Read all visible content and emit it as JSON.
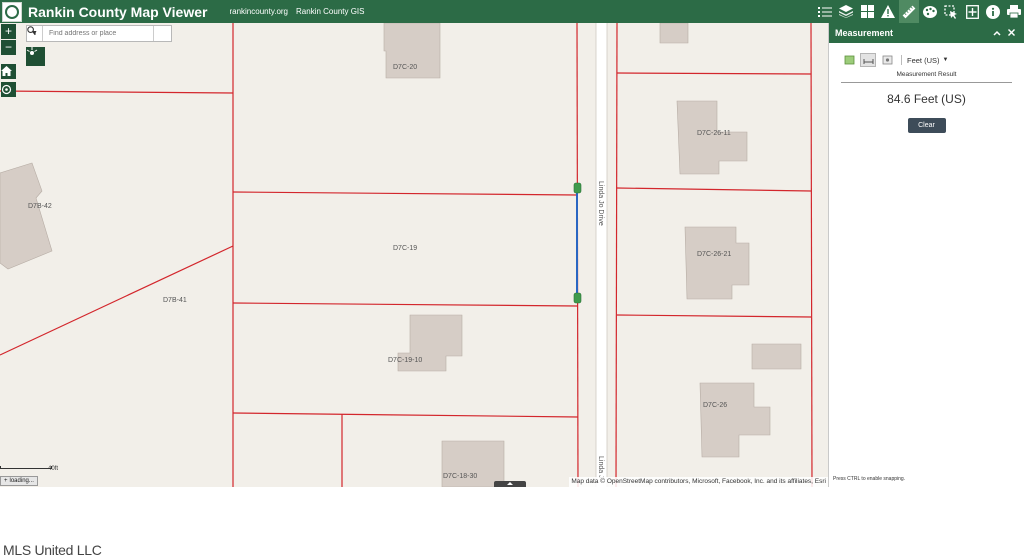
{
  "header": {
    "title": "Rankin County Map Viewer",
    "links": [
      "rankincounty.org",
      "Rankin County GIS"
    ],
    "tools": [
      {
        "icon": "legend-list-icon",
        "active": false
      },
      {
        "icon": "layers-icon",
        "active": false
      },
      {
        "icon": "basemap-grid-icon",
        "active": false
      },
      {
        "icon": "warning-triangle-icon",
        "active": false
      },
      {
        "icon": "measure-ruler-icon",
        "active": true
      },
      {
        "icon": "draw-palette-icon",
        "active": false
      },
      {
        "icon": "select-tool-icon",
        "active": false
      },
      {
        "icon": "add-data-icon",
        "active": false
      },
      {
        "icon": "info-icon",
        "active": false
      },
      {
        "icon": "print-icon",
        "active": false
      }
    ]
  },
  "map": {
    "search_placeholder": "Find address or place",
    "scale_label": "40ft",
    "loading_text": "loading...",
    "attribution": "Map data © OpenStreetMap contributors, Microsoft, Facebook, Inc. and its affiliates, Esri",
    "street_label": "Linda Jo Drive",
    "street_label_partial": "Linda J",
    "parcel_labels": [
      "D7C-20",
      "D7B-42",
      "D7C-19",
      "D7B-41",
      "D7C-19-10",
      "D7C-18-30",
      "D7C-26-11",
      "D7C-26-21",
      "D7C-26"
    ],
    "measurement_color": "#2a66c2",
    "measurement_vertex_color": "#3f9a4c"
  },
  "panel": {
    "title": "Measurement",
    "unit": "Feet (US)",
    "result_label": "Measurement Result",
    "result_value": "84.6 Feet (US)",
    "clear_label": "Clear",
    "hint": "Press CTRL to enable snapping."
  },
  "footer": {
    "watermark": "MLS United LLC"
  },
  "colors": {
    "header": "#2c6b46",
    "parcel_line": "#d3262c",
    "building": "#d6cdc6",
    "map_background": "#f2efe9"
  }
}
